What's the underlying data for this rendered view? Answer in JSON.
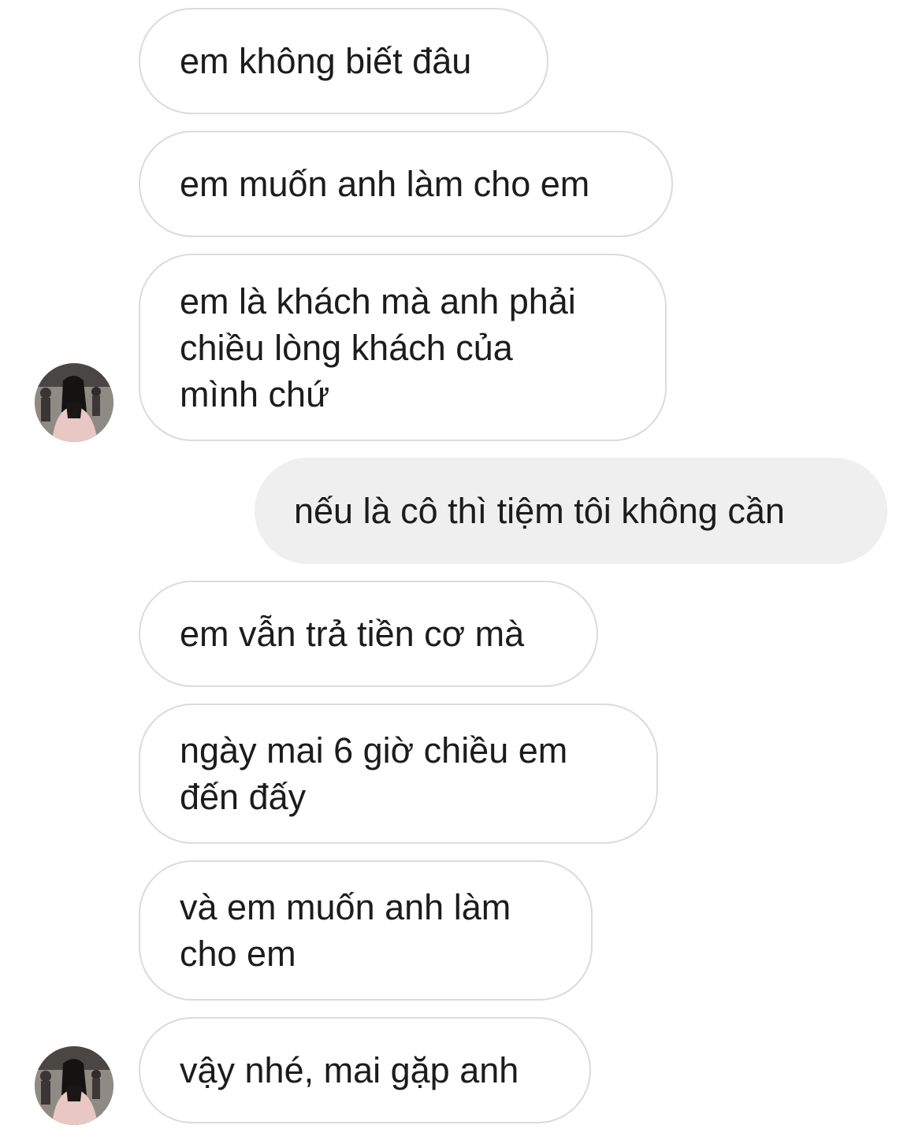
{
  "messages": [
    {
      "side": "received",
      "text": "em không biết đâu"
    },
    {
      "side": "received",
      "text": "em muốn anh làm cho em"
    },
    {
      "side": "received",
      "text": "em là khách mà anh phải\nchiều lòng khách của\nmình chứ"
    },
    {
      "side": "sent",
      "text": "nếu là cô thì tiệm tôi không cần"
    },
    {
      "side": "received",
      "text": "em vẫn trả tiền cơ mà"
    },
    {
      "side": "received",
      "text": "ngày mai 6 giờ chiều em\nđến đấy"
    },
    {
      "side": "received",
      "text": "và em muốn anh làm\ncho em"
    },
    {
      "side": "received",
      "text": "vậy nhé, mai gặp anh"
    }
  ],
  "colors": {
    "received_bubble_border": "#dbdbdb",
    "sent_bubble_background": "#efefef",
    "text": "#1c1c1c"
  }
}
